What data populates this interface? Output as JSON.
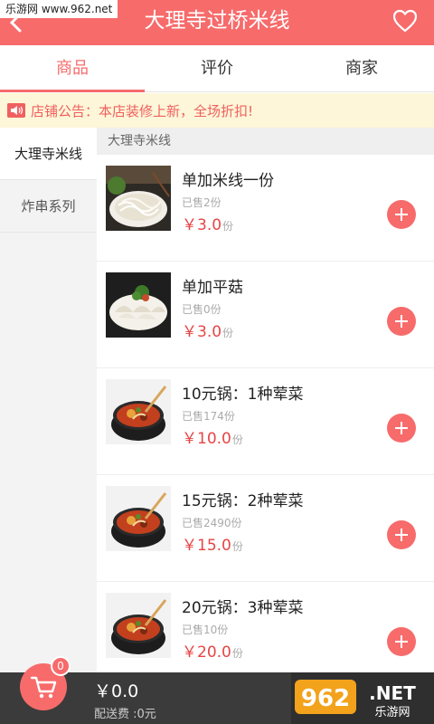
{
  "watermark": {
    "top_left": "乐游网 www.962.net",
    "bottom_brand": "962",
    "bottom_suffix": ".NET",
    "bottom_caption": "乐游网"
  },
  "header": {
    "title": "大理寺过桥米线",
    "back_icon": "chevron-left-icon",
    "favorite_icon": "heart-outline-icon"
  },
  "tabs": [
    {
      "label": "商品",
      "active": true
    },
    {
      "label": "评价",
      "active": false
    },
    {
      "label": "商家",
      "active": false
    }
  ],
  "notice": {
    "text": "店铺公告：本店装修上新，全场折扣!",
    "icon": "speaker-icon"
  },
  "sidebar": {
    "items": [
      {
        "label": "大理寺米线",
        "active": true
      },
      {
        "label": "炸串系列",
        "active": false
      }
    ]
  },
  "section": {
    "title": "大理寺米线"
  },
  "products": [
    {
      "name": "单加米线一份",
      "sold": "已售2份",
      "price": "￥3.0",
      "unit": "份",
      "image": "noodles"
    },
    {
      "name": "单加平菇",
      "sold": "已售0份",
      "price": "￥3.0",
      "unit": "份",
      "image": "mushroom"
    },
    {
      "name": "10元锅：1种荤菜",
      "sold": "已售174份",
      "price": "￥10.0",
      "unit": "份",
      "image": "pot"
    },
    {
      "name": "15元锅：2种荤菜",
      "sold": "已售2490份",
      "price": "￥15.0",
      "unit": "份",
      "image": "pot"
    },
    {
      "name": "20元锅：3种荤菜",
      "sold": "已售10份",
      "price": "￥20.0",
      "unit": "份",
      "image": "pot"
    }
  ],
  "cart": {
    "count": "0",
    "total": "￥0.0",
    "delivery": "配送费 :0元",
    "icon": "shopping-cart-icon"
  },
  "colors": {
    "accent": "#f76b6b",
    "price": "#e64545",
    "notice_bg": "#fdf6d8",
    "bar": "#3b3b3b"
  }
}
